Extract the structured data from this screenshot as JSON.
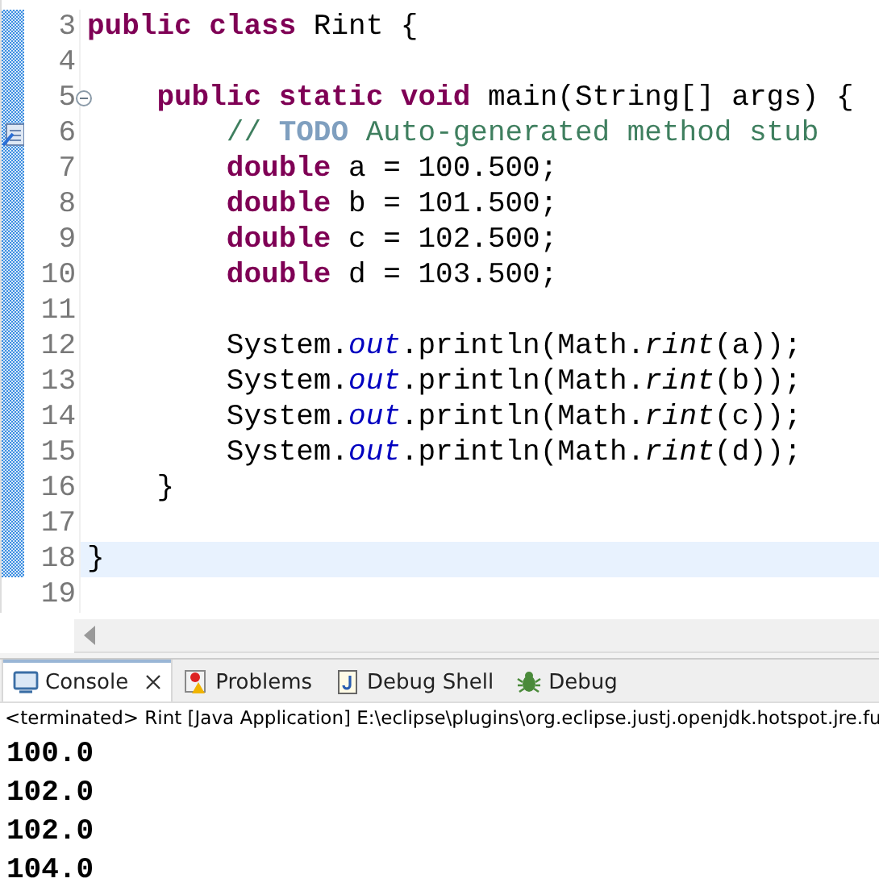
{
  "editor": {
    "lines": [
      {
        "number": "3",
        "changed": true,
        "current": false,
        "kind": "plain",
        "tokens": [
          {
            "text": "public class",
            "kind": "keyword"
          },
          {
            "text": " Rint {",
            "kind": "plain"
          }
        ]
      },
      {
        "number": "4",
        "changed": true,
        "current": false,
        "kind": "plain"
      },
      {
        "number": "5",
        "changed": true,
        "current": false,
        "kind": "fold",
        "tokens": [
          {
            "text": "    public static void",
            "kind": "keyword"
          },
          {
            "text": " main(String[] args) {",
            "kind": "plain"
          }
        ]
      },
      {
        "number": "6",
        "changed": true,
        "current": false,
        "kind": "task",
        "tokens": [
          {
            "text": "        // ",
            "kind": "comment"
          },
          {
            "text": "TODO",
            "kind": "todo"
          },
          {
            "text": " Auto-generated method stub",
            "kind": "comment"
          }
        ]
      },
      {
        "number": "7",
        "changed": true,
        "current": false,
        "kind": "plain",
        "tokens": [
          {
            "text": "        double",
            "kind": "keyword"
          },
          {
            "text": " a = 100.500;",
            "kind": "plain"
          }
        ]
      },
      {
        "number": "8",
        "changed": true,
        "current": false,
        "kind": "plain",
        "tokens": [
          {
            "text": "        double",
            "kind": "keyword"
          },
          {
            "text": " b = 101.500;",
            "kind": "plain"
          }
        ]
      },
      {
        "number": "9",
        "changed": true,
        "current": false,
        "kind": "plain",
        "tokens": [
          {
            "text": "        double",
            "kind": "keyword"
          },
          {
            "text": " c = 102.500;",
            "kind": "plain"
          }
        ]
      },
      {
        "number": "10",
        "changed": true,
        "current": false,
        "kind": "plain",
        "tokens": [
          {
            "text": "        double",
            "kind": "keyword"
          },
          {
            "text": " d = 103.500;",
            "kind": "plain"
          }
        ]
      },
      {
        "number": "11",
        "changed": true,
        "current": false,
        "kind": "plain"
      },
      {
        "number": "12",
        "changed": true,
        "current": false,
        "kind": "plain",
        "tokens": [
          {
            "text": "        System.",
            "kind": "plain"
          },
          {
            "text": "out",
            "kind": "field"
          },
          {
            "text": ".println(Math.",
            "kind": "plain"
          },
          {
            "text": "rint",
            "kind": "static"
          },
          {
            "text": "(a));",
            "kind": "plain"
          }
        ]
      },
      {
        "number": "13",
        "changed": true,
        "current": false,
        "kind": "plain",
        "tokens": [
          {
            "text": "        System.",
            "kind": "plain"
          },
          {
            "text": "out",
            "kind": "field"
          },
          {
            "text": ".println(Math.",
            "kind": "plain"
          },
          {
            "text": "rint",
            "kind": "static"
          },
          {
            "text": "(b));",
            "kind": "plain"
          }
        ]
      },
      {
        "number": "14",
        "changed": true,
        "current": false,
        "kind": "plain",
        "tokens": [
          {
            "text": "        System.",
            "kind": "plain"
          },
          {
            "text": "out",
            "kind": "field"
          },
          {
            "text": ".println(Math.",
            "kind": "plain"
          },
          {
            "text": "rint",
            "kind": "static"
          },
          {
            "text": "(c));",
            "kind": "plain"
          }
        ]
      },
      {
        "number": "15",
        "changed": true,
        "current": false,
        "kind": "plain",
        "tokens": [
          {
            "text": "        System.",
            "kind": "plain"
          },
          {
            "text": "out",
            "kind": "field"
          },
          {
            "text": ".println(Math.",
            "kind": "plain"
          },
          {
            "text": "rint",
            "kind": "static"
          },
          {
            "text": "(d));",
            "kind": "plain"
          }
        ]
      },
      {
        "number": "16",
        "changed": true,
        "current": false,
        "kind": "plain",
        "tokens": [
          {
            "text": "    }",
            "kind": "plain"
          }
        ]
      },
      {
        "number": "17",
        "changed": true,
        "current": false,
        "kind": "plain"
      },
      {
        "number": "18",
        "changed": true,
        "current": true,
        "kind": "plain",
        "tokens": [
          {
            "text": "}",
            "kind": "plain"
          }
        ]
      },
      {
        "number": "19",
        "changed": false,
        "current": false,
        "kind": "plain"
      }
    ]
  },
  "console": {
    "tabs": [
      {
        "label": "Console",
        "selected": true,
        "closable": true
      },
      {
        "label": "Problems",
        "selected": false,
        "closable": false
      },
      {
        "label": "Debug Shell",
        "selected": false,
        "closable": false
      },
      {
        "label": "Debug",
        "selected": false,
        "closable": false
      }
    ],
    "status": "<terminated> Rint [Java Application] E:\\eclipse\\plugins\\org.eclipse.justj.openjdk.hotspot.jre.fu",
    "output": [
      "100.0",
      "102.0",
      "102.0",
      "104.0"
    ]
  }
}
